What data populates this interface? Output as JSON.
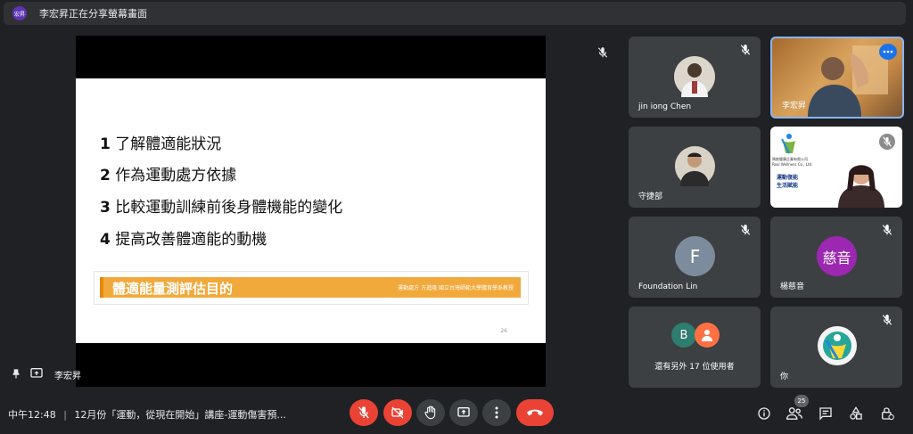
{
  "topbar": {
    "avatar_text": "宏昇",
    "sharing_text": "李宏昇正在分享螢幕畫面"
  },
  "presenter": {
    "name": "李宏昇"
  },
  "slide": {
    "items": [
      {
        "num": "1",
        "text": "了解體適能狀況"
      },
      {
        "num": "2",
        "text": "作為運動處方依據"
      },
      {
        "num": "3",
        "text": "比較運動訓練前後身體機能的變化"
      },
      {
        "num": "4",
        "text": "提高改善體適能的動機"
      }
    ],
    "banner_title": "體適能量測評估目的",
    "banner_note": "運動處方 方進隆 國立台灣師範大學體育學系教授",
    "page_number": "26"
  },
  "participants": [
    {
      "name": "jin iong Chen",
      "muted": true
    },
    {
      "name": "李宏昇",
      "muted": false
    },
    {
      "name": "守捷部",
      "muted": false
    },
    {
      "name": "",
      "muted": true,
      "logo_text": "興創健康企業有限公司",
      "logo_subtext": "Real Wellness Co., Ltd.",
      "slogan": [
        "運動復能",
        "生活賦能"
      ]
    },
    {
      "name": "Foundation Lin",
      "initial": "F",
      "color": "#7c8c9c",
      "muted": true
    },
    {
      "name": "楊慈音",
      "initial": "慈音",
      "color": "#9c27b0",
      "muted": true
    },
    {
      "others_label": "還有另外 17 位使用者",
      "initials": [
        "B"
      ],
      "colors": [
        "#2e7d6e",
        "#ff7043"
      ]
    },
    {
      "name": "你",
      "muted": true
    }
  ],
  "bottom": {
    "time": "中午12:48",
    "separator": "|",
    "meeting_title": "12月份「運動，從現在開始」講座-運動傷害預...",
    "people_count": "25"
  }
}
